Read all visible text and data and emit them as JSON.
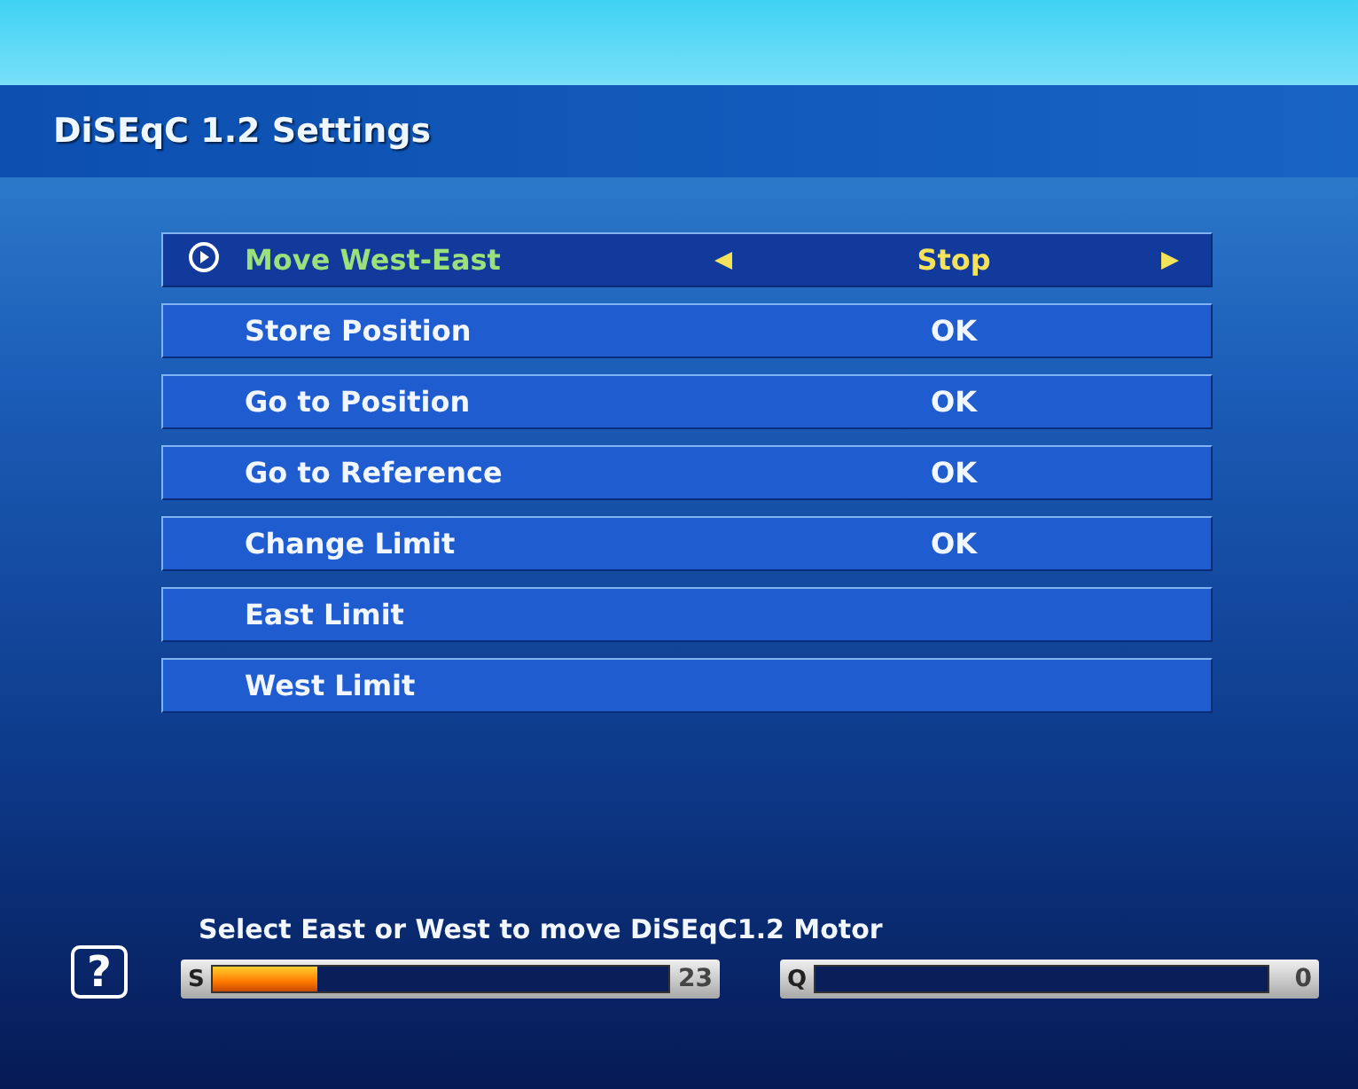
{
  "title": "DiSEqC 1.2 Settings",
  "rows": [
    {
      "label": "Move West-East",
      "value": "Stop",
      "kind": "choice",
      "selected": true
    },
    {
      "label": "Store Position",
      "value": "OK",
      "kind": "action",
      "selected": false
    },
    {
      "label": "Go to Position",
      "value": "OK",
      "kind": "action",
      "selected": false
    },
    {
      "label": "Go to Reference",
      "value": "OK",
      "kind": "action",
      "selected": false
    },
    {
      "label": "Change Limit",
      "value": "OK",
      "kind": "action",
      "selected": false
    },
    {
      "label": "East Limit",
      "kind": "action",
      "selected": false
    },
    {
      "label": "West Limit",
      "kind": "action",
      "selected": false
    }
  ],
  "help": {
    "key": "?",
    "text": "Select East or West to move DiSEqC1.2 Motor"
  },
  "meters": [
    {
      "label": "S",
      "level": 0.23,
      "reading": "23"
    },
    {
      "label": "Q",
      "level": 0,
      "reading": "0"
    }
  ]
}
